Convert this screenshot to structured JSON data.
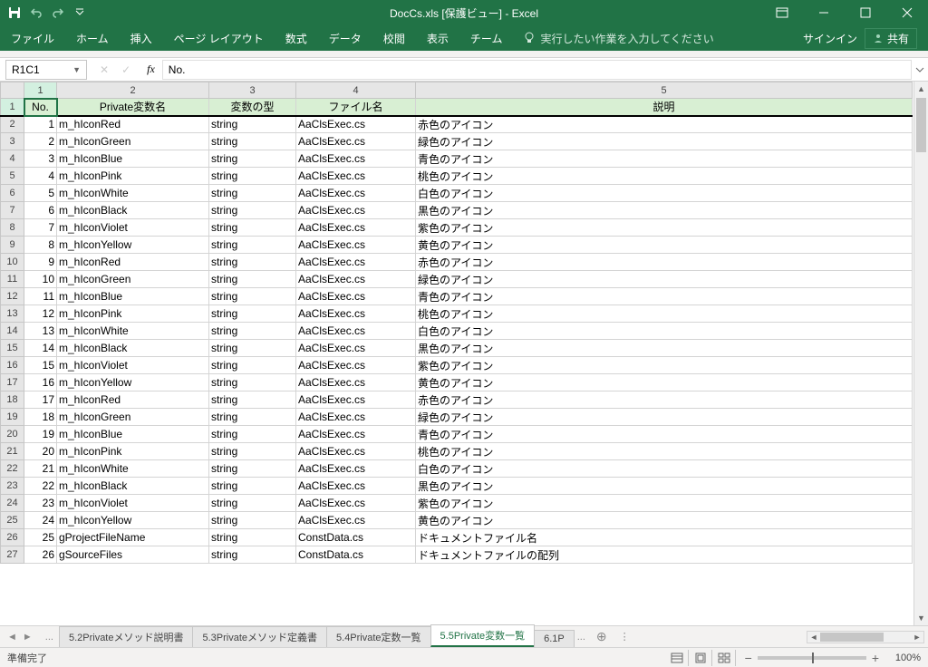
{
  "titlebar": {
    "title": "DocCs.xls  [保護ビュー] - Excel"
  },
  "ribbon": {
    "tabs": [
      "ファイル",
      "ホーム",
      "挿入",
      "ページ レイアウト",
      "数式",
      "データ",
      "校閲",
      "表示",
      "チーム"
    ],
    "tellme": "実行したい作業を入力してください",
    "signin": "サインイン",
    "share": "共有"
  },
  "formula": {
    "name_box": "R1C1",
    "fx_label": "fx",
    "value": "No."
  },
  "col_numbers": [
    "1",
    "2",
    "3",
    "4",
    "5"
  ],
  "headers": {
    "no": "No.",
    "var": "Private変数名",
    "type": "変数の型",
    "file": "ファイル名",
    "desc": "説明"
  },
  "rows": [
    {
      "n": "1",
      "v": "m_hIconRed",
      "t": "string",
      "f": "AaClsExec.cs",
      "d": "赤色のアイコン"
    },
    {
      "n": "2",
      "v": "m_hIconGreen",
      "t": "string",
      "f": "AaClsExec.cs",
      "d": "緑色のアイコン"
    },
    {
      "n": "3",
      "v": "m_hIconBlue",
      "t": "string",
      "f": "AaClsExec.cs",
      "d": "青色のアイコン"
    },
    {
      "n": "4",
      "v": "m_hIconPink",
      "t": "string",
      "f": "AaClsExec.cs",
      "d": "桃色のアイコン"
    },
    {
      "n": "5",
      "v": "m_hIconWhite",
      "t": "string",
      "f": "AaClsExec.cs",
      "d": "白色のアイコン"
    },
    {
      "n": "6",
      "v": "m_hIconBlack",
      "t": "string",
      "f": "AaClsExec.cs",
      "d": "黒色のアイコン"
    },
    {
      "n": "7",
      "v": "m_hIconViolet",
      "t": "string",
      "f": "AaClsExec.cs",
      "d": "紫色のアイコン"
    },
    {
      "n": "8",
      "v": "m_hIconYellow",
      "t": "string",
      "f": "AaClsExec.cs",
      "d": "黄色のアイコン"
    },
    {
      "n": "9",
      "v": "m_hIconRed",
      "t": "string",
      "f": "AaClsExec.cs",
      "d": "赤色のアイコン"
    },
    {
      "n": "10",
      "v": "m_hIconGreen",
      "t": "string",
      "f": "AaClsExec.cs",
      "d": "緑色のアイコン"
    },
    {
      "n": "11",
      "v": "m_hIconBlue",
      "t": "string",
      "f": "AaClsExec.cs",
      "d": "青色のアイコン"
    },
    {
      "n": "12",
      "v": "m_hIconPink",
      "t": "string",
      "f": "AaClsExec.cs",
      "d": "桃色のアイコン"
    },
    {
      "n": "13",
      "v": "m_hIconWhite",
      "t": "string",
      "f": "AaClsExec.cs",
      "d": "白色のアイコン"
    },
    {
      "n": "14",
      "v": "m_hIconBlack",
      "t": "string",
      "f": "AaClsExec.cs",
      "d": "黒色のアイコン"
    },
    {
      "n": "15",
      "v": "m_hIconViolet",
      "t": "string",
      "f": "AaClsExec.cs",
      "d": "紫色のアイコン"
    },
    {
      "n": "16",
      "v": "m_hIconYellow",
      "t": "string",
      "f": "AaClsExec.cs",
      "d": "黄色のアイコン"
    },
    {
      "n": "17",
      "v": "m_hIconRed",
      "t": "string",
      "f": "AaClsExec.cs",
      "d": "赤色のアイコン"
    },
    {
      "n": "18",
      "v": "m_hIconGreen",
      "t": "string",
      "f": "AaClsExec.cs",
      "d": "緑色のアイコン"
    },
    {
      "n": "19",
      "v": "m_hIconBlue",
      "t": "string",
      "f": "AaClsExec.cs",
      "d": "青色のアイコン"
    },
    {
      "n": "20",
      "v": "m_hIconPink",
      "t": "string",
      "f": "AaClsExec.cs",
      "d": "桃色のアイコン"
    },
    {
      "n": "21",
      "v": "m_hIconWhite",
      "t": "string",
      "f": "AaClsExec.cs",
      "d": "白色のアイコン"
    },
    {
      "n": "22",
      "v": "m_hIconBlack",
      "t": "string",
      "f": "AaClsExec.cs",
      "d": "黒色のアイコン"
    },
    {
      "n": "23",
      "v": "m_hIconViolet",
      "t": "string",
      "f": "AaClsExec.cs",
      "d": "紫色のアイコン"
    },
    {
      "n": "24",
      "v": "m_hIconYellow",
      "t": "string",
      "f": "AaClsExec.cs",
      "d": "黄色のアイコン"
    },
    {
      "n": "25",
      "v": "gProjectFileName",
      "t": "string",
      "f": "ConstData.cs",
      "d": "ドキュメントファイル名"
    },
    {
      "n": "26",
      "v": "gSourceFiles",
      "t": "string",
      "f": "ConstData.cs",
      "d": "ドキュメントファイルの配列"
    }
  ],
  "sheet_tabs": {
    "ellipsis": "...",
    "items": [
      "5.2Privateメソッド説明書",
      "5.3Privateメソッド定義書",
      "5.4Private定数一覧",
      "5.5Private変数一覧",
      "6.1P"
    ],
    "more": "...",
    "active_index": 3
  },
  "status": {
    "ready": "準備完了",
    "zoom": "100%"
  }
}
